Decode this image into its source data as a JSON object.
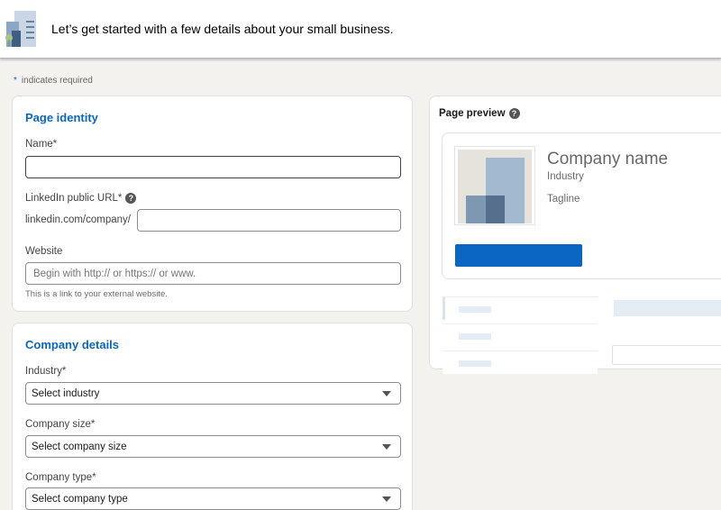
{
  "header": {
    "title": "Let’s get started with a few details about your small business."
  },
  "required_note": {
    "star": "*",
    "text": "indicates required"
  },
  "page_identity": {
    "section_title": "Page identity",
    "name_label": "Name*",
    "name_value": "",
    "url_label": "LinkedIn public URL*",
    "url_prefix": "linkedin.com/company/",
    "url_value": "",
    "website_label": "Website",
    "website_placeholder": "Begin with http:// or https:// or www.",
    "website_hint": "This is a link to your external website."
  },
  "company_details": {
    "section_title": "Company details",
    "industry_label": "Industry*",
    "industry_value": "Select industry",
    "size_label": "Company size*",
    "size_value": "Select company size",
    "type_label": "Company type*",
    "type_value": "Select company type"
  },
  "preview": {
    "title": "Page preview",
    "company_name": "Company name",
    "industry": "Industry",
    "tagline": "Tagline"
  },
  "icons": {
    "help": "?",
    "logo": "building-icon"
  },
  "colors": {
    "accent": "#0a66c2",
    "background": "#f3f2ef",
    "skeleton": "#e4ecf4"
  }
}
